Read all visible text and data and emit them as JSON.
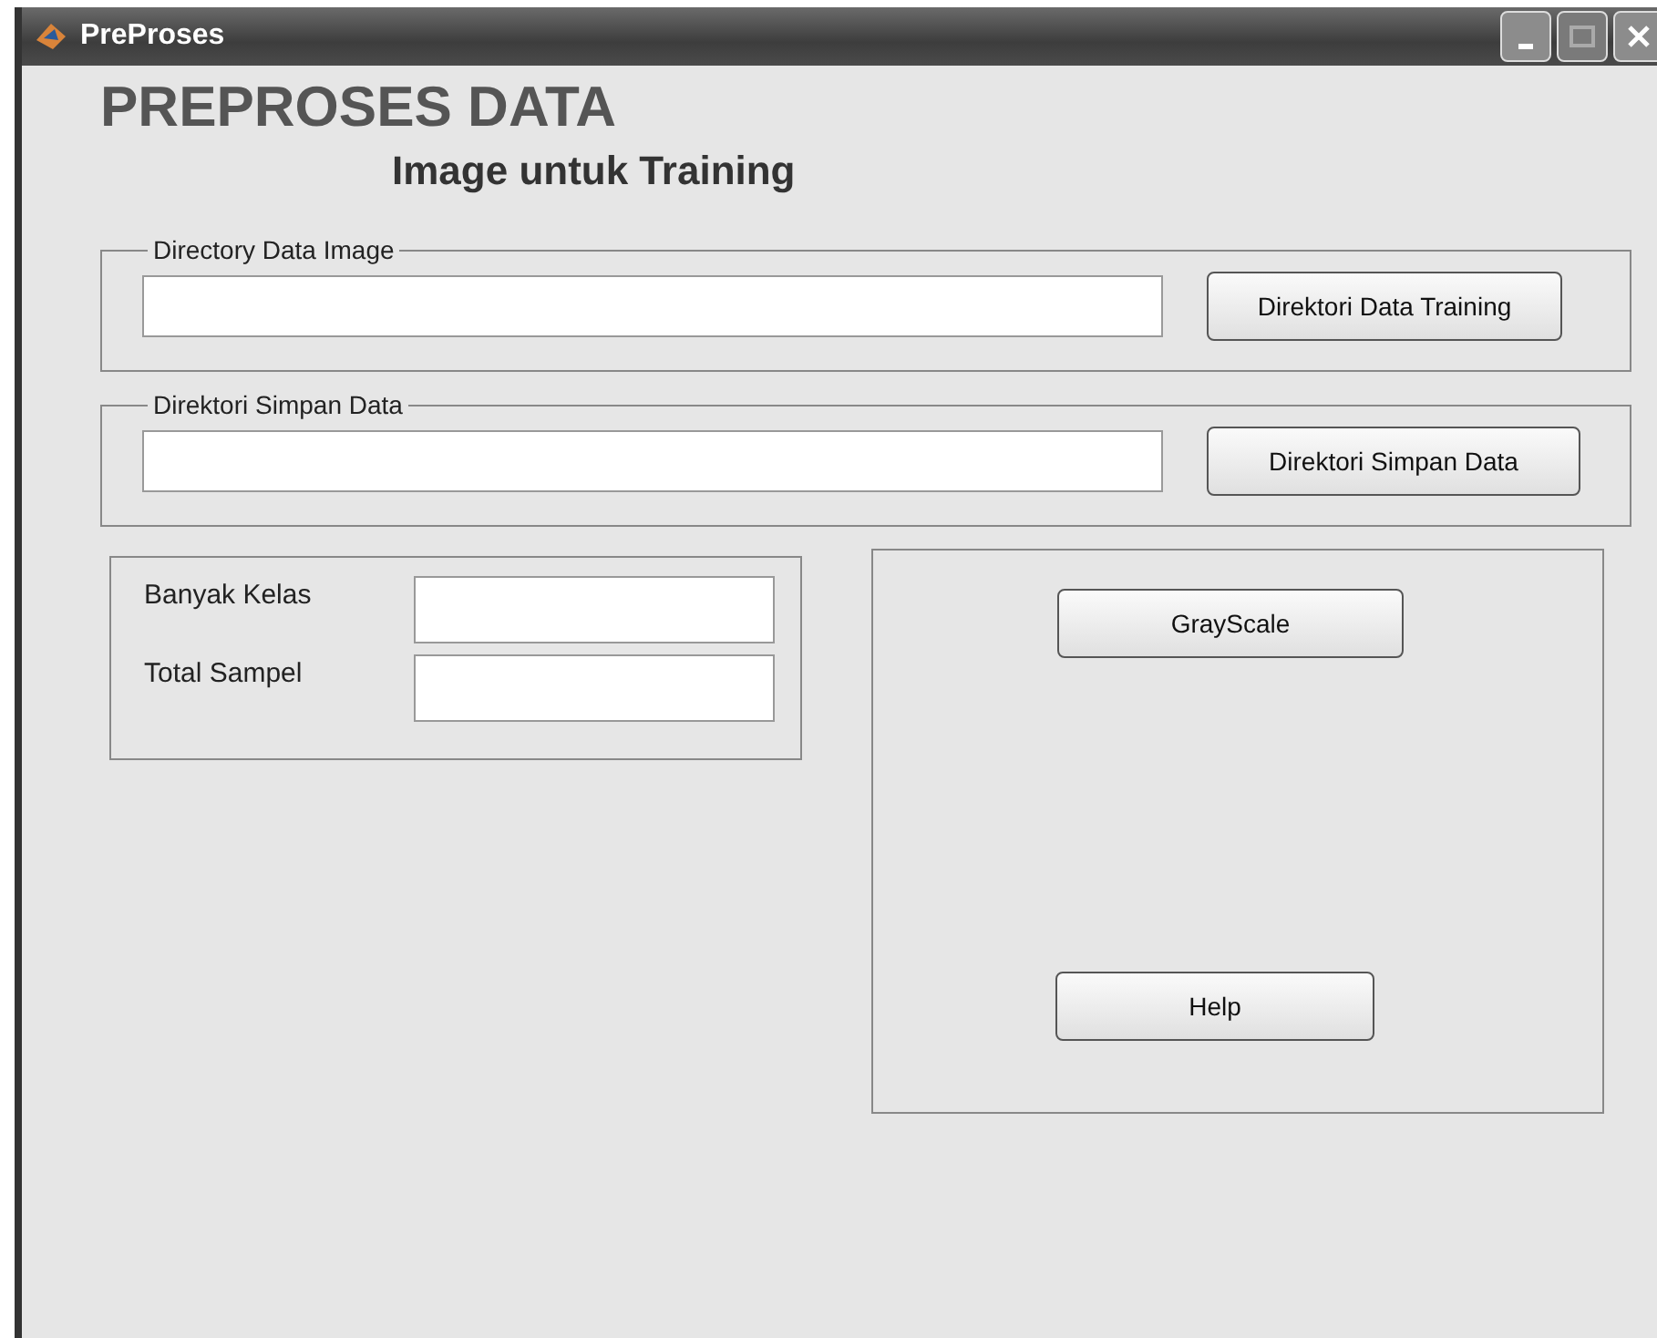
{
  "window": {
    "title": "PreProses"
  },
  "heading": "PREPROSES DATA",
  "subheading": "Image untuk Training",
  "path_panels": [
    {
      "legend": "Directory Data Image",
      "button": "Direktori Data Training"
    },
    {
      "legend": "Direktori Simpan Data",
      "button": "Direktori Simpan Data"
    }
  ],
  "stats_panel": {
    "fields": [
      {
        "label": "Banyak Kelas"
      },
      {
        "label": "Total Sampel"
      }
    ]
  },
  "action_panel": {
    "buttons": [
      "GrayScale",
      "Help"
    ]
  }
}
